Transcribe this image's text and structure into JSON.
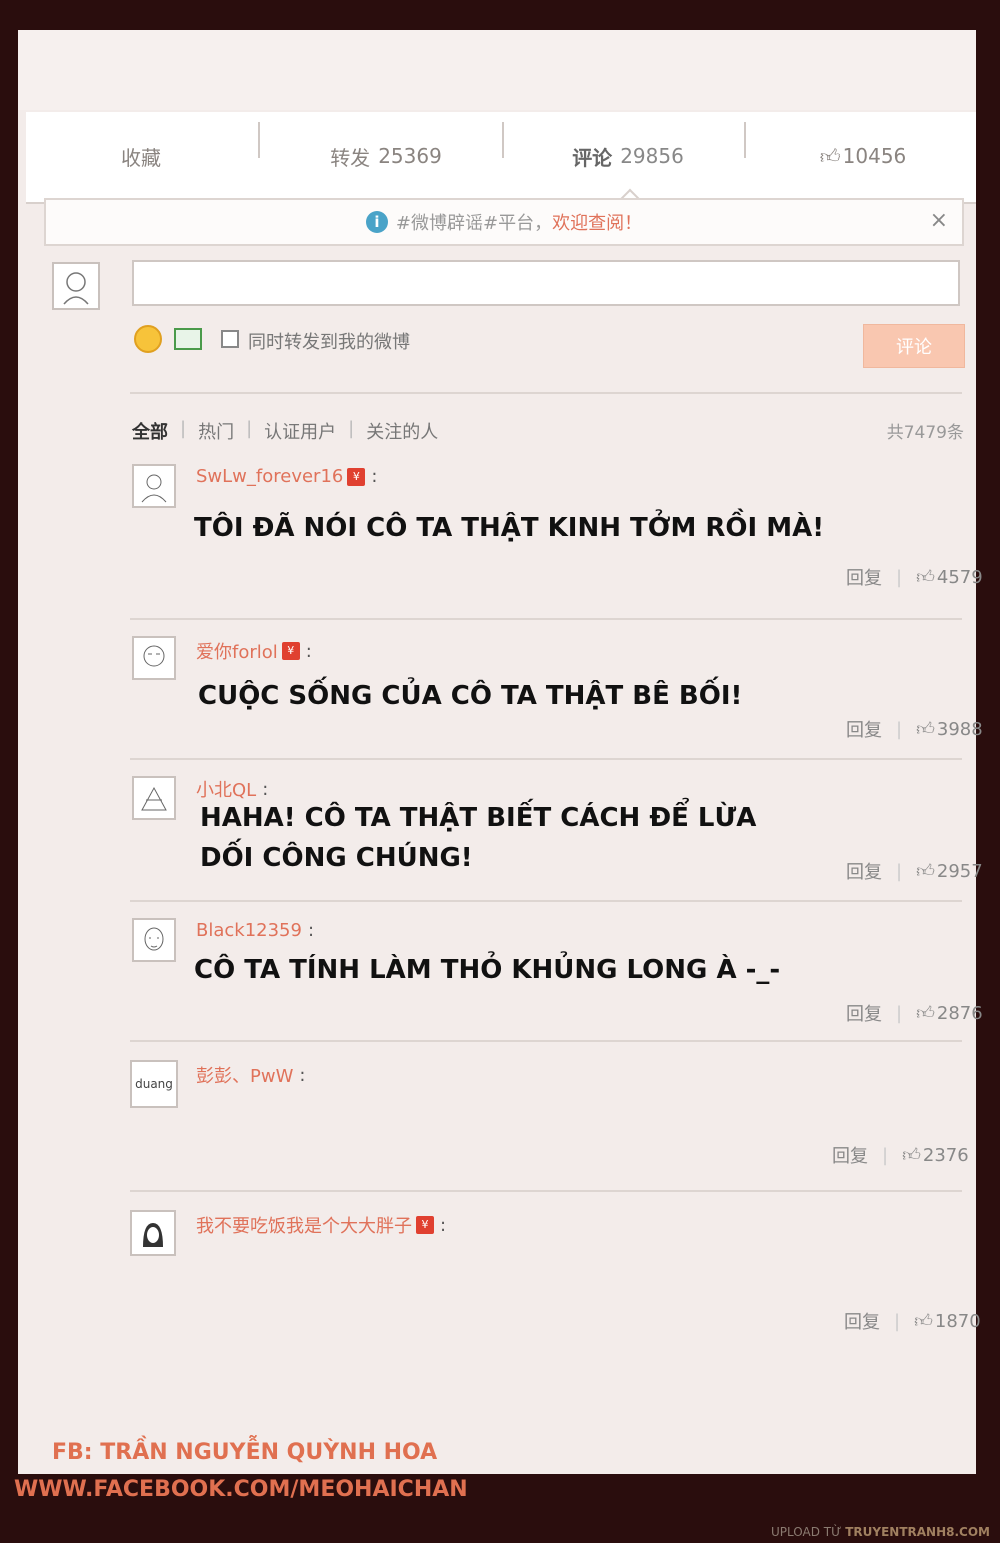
{
  "tabs": [
    {
      "label": "收藏",
      "count": ""
    },
    {
      "label": "转发",
      "count": "25369"
    },
    {
      "label": "评论",
      "count": "29856"
    },
    {
      "label": "",
      "count": "10456"
    }
  ],
  "notice": {
    "text": "#微博辟谣#平台，",
    "welcome": "欢迎查阅！",
    "close": "×"
  },
  "composer": {
    "repost_label": "同时转发到我的微博",
    "submit_label": "评论"
  },
  "filters": {
    "items": [
      "全部",
      "热门",
      "认证用户",
      "关注的人"
    ],
    "total": "共7479条"
  },
  "comments": [
    {
      "user": "SwLw_forever16",
      "vip": true,
      "text": "TÔI ĐÃ NÓI CÔ TA THẬT KINH TỞM RỒI MÀ!",
      "reply": "回复",
      "likes": "4579"
    },
    {
      "user": "爱你forlol",
      "vip": true,
      "text": "CUỘC SỐNG CỦA CÔ TA THẬT BÊ BỐI!",
      "reply": "回复",
      "likes": "3988"
    },
    {
      "user": "小北QL",
      "vip": false,
      "text": "HAHA! CÔ TA THẬT BIẾT CÁCH ĐỂ LỪA",
      "text2": "DỐI CÔNG CHÚNG!",
      "reply": "回复",
      "likes": "2957"
    },
    {
      "user": "Black12359",
      "vip": false,
      "text": "CÔ TA TÍNH LÀM THỎ KHỦNG LONG À -_-",
      "reply": "回复",
      "likes": "2876"
    },
    {
      "user": "彭彭、PwW",
      "vip": false,
      "text": "",
      "reply": "回复",
      "likes": "2376",
      "avatar_text": "duang"
    },
    {
      "user": "我不要吃饭我是个大大胖子",
      "vip": true,
      "text": "",
      "reply": "回复",
      "likes": "1870"
    }
  ],
  "credits": {
    "fb": "FB: TRẦN NGUYỄN QUỲNH HOA",
    "url": "WWW.FACEBOOK.COM/MEOHAICHAN",
    "upload_prefix": "UPLOAD TỪ",
    "upload_site": "TRUYENTRANH8.COM"
  },
  "colors": {
    "accent": "#e0725a",
    "background": "#f3ecea",
    "frame": "#2a0d0d"
  }
}
